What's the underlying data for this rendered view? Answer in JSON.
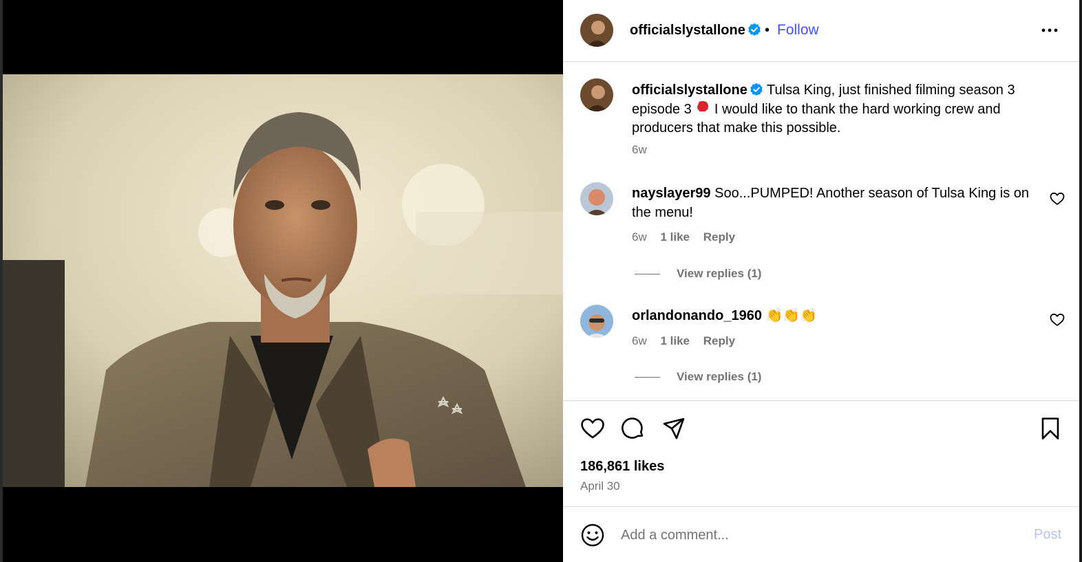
{
  "post": {
    "author": "officialslystallone",
    "follow_label": "Follow",
    "dot": "•",
    "caption_part1": "Tulsa King, just finished filming season 3 episode 3",
    "caption_part2": "I would like to thank the hard working crew and producers that make this possible.",
    "caption_time": "6w"
  },
  "comments": [
    {
      "username": "nayslayer99",
      "text": "Soo...PUMPED! Another season of Tulsa King is on the menu!",
      "time": "6w",
      "likes": "1 like",
      "reply_label": "Reply",
      "view_replies": "View replies (1)"
    },
    {
      "username": "orlandonando_1960",
      "text": "👏👏👏",
      "time": "6w",
      "likes": "1 like",
      "reply_label": "Reply",
      "view_replies": "View replies (1)"
    }
  ],
  "actions": {
    "likes_count": "186,861 likes",
    "date": "April 30"
  },
  "add_comment": {
    "placeholder": "Add a comment...",
    "post_label": "Post"
  },
  "colors": {
    "link_blue": "#4150f7",
    "verified_blue": "#0095f6",
    "muted": "#737373",
    "post_disabled": "#b3c3f7"
  },
  "icons": [
    "verified-badge-icon",
    "more-options-icon",
    "heart-icon",
    "comment-icon",
    "share-icon",
    "bookmark-icon",
    "emoji-icon",
    "boxing-glove-icon"
  ]
}
